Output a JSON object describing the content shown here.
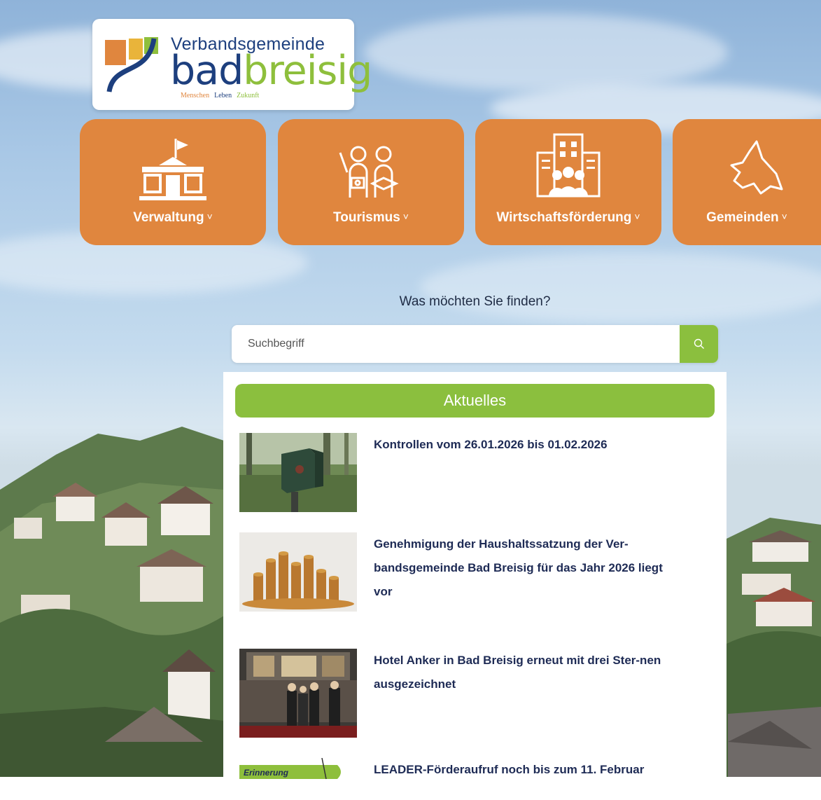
{
  "logo": {
    "top_text": "Verbandsgemeinde",
    "main_part1": "bad",
    "main_part2": "breisig",
    "tagline": [
      "Menschen",
      "Leben",
      "Zukunft"
    ],
    "colors": {
      "navy": "#1d3f7e",
      "green": "#8ebf3c",
      "orange": "#e0863e"
    }
  },
  "nav": [
    {
      "label": "Verwaltung",
      "caret": "˅",
      "icon": "town-hall-icon"
    },
    {
      "label": "Tourismus",
      "caret": "˅",
      "icon": "tourists-icon"
    },
    {
      "label": "Wirtschaftsförderung",
      "caret": "˅",
      "icon": "business-building-icon"
    },
    {
      "label": "Gemeinden",
      "caret": "˅",
      "icon": "region-map-icon"
    }
  ],
  "search": {
    "prompt": "Was möchten Sie finden?",
    "placeholder": "Suchbegriff",
    "button_icon": "search-icon"
  },
  "news": {
    "header": "Aktuelles",
    "items": [
      {
        "title": "Kontrollen vom 26.01.2026 bis 01.02.2026",
        "thumb": "speed-camera"
      },
      {
        "title": "Genehmigung der Haushaltssatzung der Ver-bandsgemeinde Bad Breisig für das Jahr 2026 liegt vor",
        "thumb": "coins"
      },
      {
        "title": "Hotel Anker in Bad Breisig erneut mit drei Ster-nen ausgezeichnet",
        "thumb": "hotel-people"
      },
      {
        "title": "LEADER-Förderaufruf noch bis zum 11. Februar",
        "thumb": "reminder-banner",
        "thumb_text": "Erinnerung"
      }
    ]
  },
  "colors": {
    "nav_tile": "#e0863e",
    "accent_green": "#8bbf3e",
    "title_navy": "#1e2b55"
  }
}
